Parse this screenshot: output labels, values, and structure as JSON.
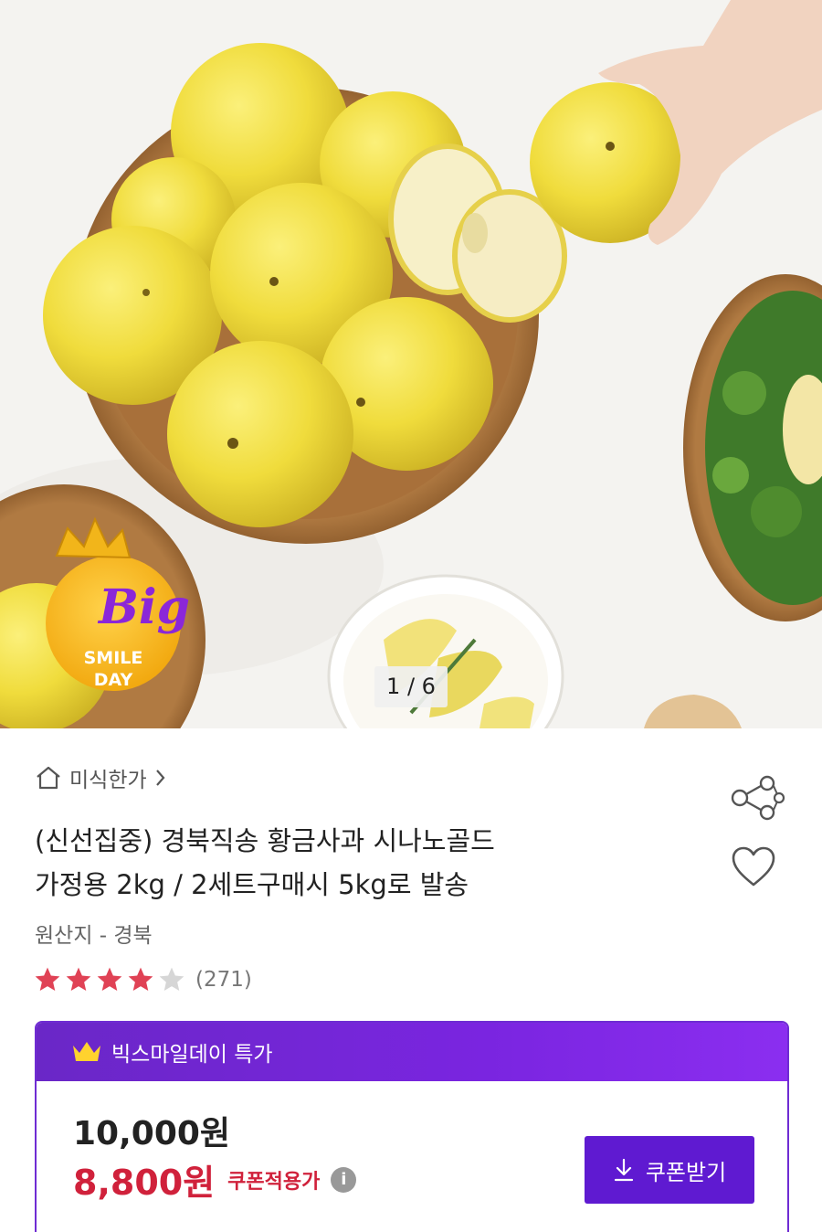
{
  "hero": {
    "badge_line1": "Big",
    "badge_line2": "SMILE",
    "badge_line3": "DAY",
    "counter": "1 / 6"
  },
  "breadcrumb": {
    "icon": "home-icon",
    "label": "미식한가",
    "chevron": "chevron-right-icon"
  },
  "product": {
    "title_line1": "(신선집중) 경북직송 황금사과 시나노골드",
    "title_line2": "가정용 2kg / 2세트구매시 5kg로 발송",
    "origin": "원산지 - 경북",
    "rating": 4,
    "rating_max": 5,
    "review_count": "(271)"
  },
  "actions": {
    "share_icon": "share-icon",
    "wishlist_icon": "heart-icon"
  },
  "deal": {
    "header_icon": "crown-icon",
    "header_label": "빅스마일데이 특가",
    "original_price": "10,000원",
    "sale_price": "8,800원",
    "sale_note": "쿠폰적용가",
    "info_icon": "info-icon",
    "coupon_button": "쿠폰받기",
    "coupon_icon": "download-icon"
  },
  "colors": {
    "accent": "#6f2cd3",
    "button": "#5f1ad1",
    "sale": "#d0213b",
    "star": "#e04255"
  }
}
